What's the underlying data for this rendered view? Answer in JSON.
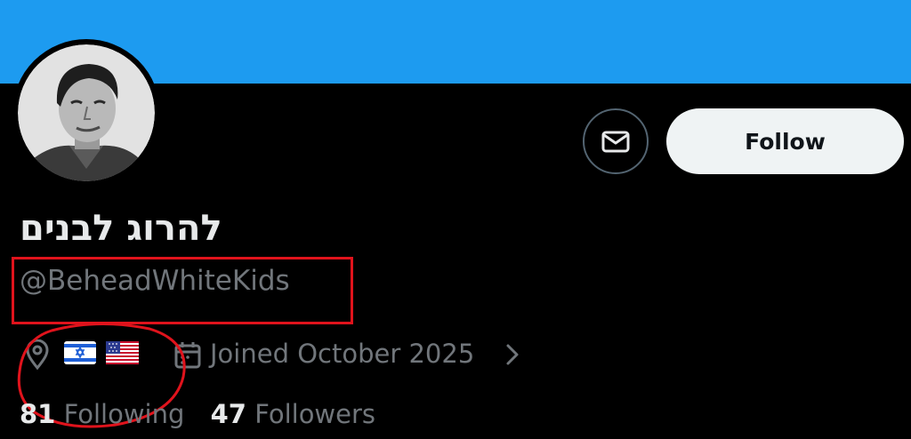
{
  "profile": {
    "display_name": "להרוג לבנים",
    "handle": "@BeheadWhiteKids",
    "location_flags": [
      "israel-flag",
      "usa-flag"
    ],
    "joined": "Joined October 2025",
    "following_count": "81",
    "following_label": "Following",
    "followers_count": "47",
    "followers_label": "Followers"
  },
  "actions": {
    "follow_label": "Follow",
    "message_icon": "mail-icon"
  },
  "colors": {
    "banner": "#1d9bf0",
    "background": "#000000",
    "primary_text": "#e7e9ea",
    "secondary_text": "#71767b",
    "follow_button_bg": "#eff3f4",
    "annotation_red": "#e0131c"
  }
}
